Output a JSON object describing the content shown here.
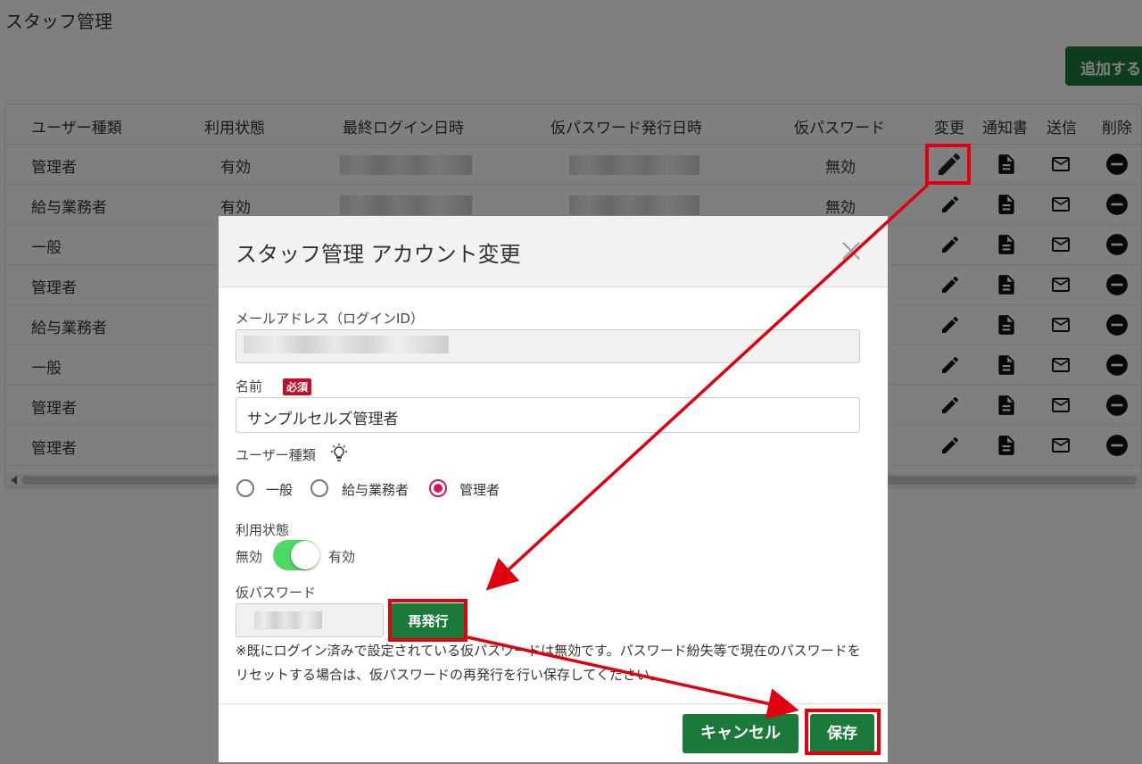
{
  "page": {
    "title": "スタッフ管理",
    "add_button": "追加する"
  },
  "table": {
    "headers": {
      "user_type": "ユーザー種類",
      "status": "利用状態",
      "last_login": "最終ログイン日時",
      "temp_pw_date": "仮パスワード発行日時",
      "temp_pw": "仮パスワード",
      "edit": "変更",
      "notice": "通知書",
      "send": "送信",
      "delete": "削除"
    },
    "rows": [
      {
        "user_type": "管理者",
        "status": "有効",
        "temp_pw": "無効"
      },
      {
        "user_type": "給与業務者",
        "status": "有効",
        "temp_pw": "無効"
      },
      {
        "user_type": "一般"
      },
      {
        "user_type": "管理者"
      },
      {
        "user_type": "給与業務者"
      },
      {
        "user_type": "一般"
      },
      {
        "user_type": "管理者"
      },
      {
        "user_type": "管理者"
      }
    ]
  },
  "modal": {
    "title": "スタッフ管理 アカウント変更",
    "email_label": "メールアドレス（ログインID）",
    "name_label": "名前",
    "required_badge": "必須",
    "name_value": "サンプルセルズ管理者",
    "user_type_label": "ユーザー種類",
    "user_type_options": [
      "一般",
      "給与業務者",
      "管理者"
    ],
    "user_type_selected": "管理者",
    "status_label": "利用状態",
    "status_off": "無効",
    "status_on": "有効",
    "status_enabled": true,
    "temp_pw_label": "仮パスワード",
    "reissue_button": "再発行",
    "note": "※既にログイン済みで設定されている仮パスワードは無効です。パスワード紛失等で現在のパスワードをリセットする場合は、仮パスワードの再発行を行い保存してください。",
    "cancel_button": "キャンセル",
    "save_button": "保存"
  },
  "colors": {
    "primary_green": "#1b7a3a",
    "annotation_red": "#e0000f",
    "radio_selected": "#d5155f",
    "toggle_on": "#4cd964"
  }
}
